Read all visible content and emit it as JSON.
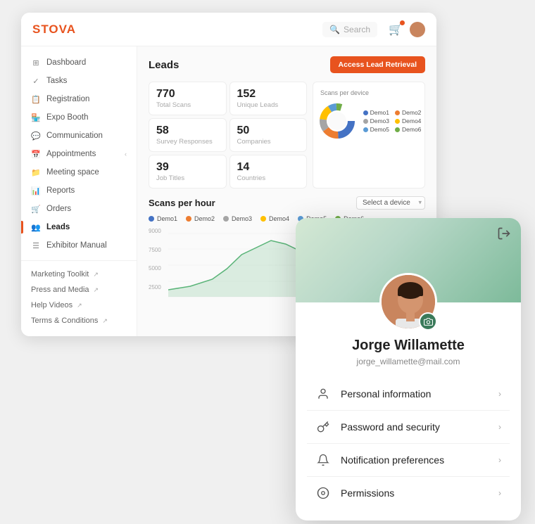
{
  "app": {
    "logo_text": "STOVA",
    "search_placeholder": "Search",
    "header": {
      "search_label": "Search"
    }
  },
  "sidebar": {
    "items": [
      {
        "id": "dashboard",
        "label": "Dashboard",
        "icon": "⊞",
        "active": false
      },
      {
        "id": "tasks",
        "label": "Tasks",
        "icon": "✓",
        "active": false
      },
      {
        "id": "registration",
        "label": "Registration",
        "icon": "📋",
        "active": false
      },
      {
        "id": "expo-booth",
        "label": "Expo Booth",
        "icon": "🏪",
        "active": false
      },
      {
        "id": "communication",
        "label": "Communication",
        "icon": "💬",
        "active": false
      },
      {
        "id": "appointments",
        "label": "Appointments",
        "icon": "📅",
        "active": false,
        "hasChevron": true
      },
      {
        "id": "meeting-space",
        "label": "Meeting space",
        "icon": "📁",
        "active": false
      },
      {
        "id": "reports",
        "label": "Reports",
        "icon": "📊",
        "active": false
      },
      {
        "id": "orders",
        "label": "Orders",
        "icon": "🛒",
        "active": false
      },
      {
        "id": "leads",
        "label": "Leads",
        "icon": "👥",
        "active": true
      },
      {
        "id": "exhibitor-manual",
        "label": "Exhibitor Manual",
        "icon": "☰",
        "active": false
      }
    ],
    "links": [
      {
        "label": "Marketing Toolkit",
        "icon": "↗"
      },
      {
        "label": "Press and Media",
        "icon": "↗"
      },
      {
        "label": "Help Videos",
        "icon": "↗"
      },
      {
        "label": "Terms & Conditions",
        "icon": "↗"
      }
    ]
  },
  "leads": {
    "title": "Leads",
    "access_btn_label": "Access Lead Retrieval",
    "stats": [
      {
        "value": "770",
        "label": "Total Scans"
      },
      {
        "value": "152",
        "label": "Unique Leads"
      },
      {
        "value": "58",
        "label": "Survey Responses"
      },
      {
        "value": "50",
        "label": "Companies"
      },
      {
        "value": "39",
        "label": "Job Titles"
      },
      {
        "value": "14",
        "label": "Countries"
      }
    ],
    "donut": {
      "title": "Scans per device",
      "segments": [
        {
          "label": "Demo1",
          "color": "#4472c4",
          "value": 30
        },
        {
          "label": "Demo2",
          "color": "#ed7d31",
          "value": 20
        },
        {
          "label": "Demo3",
          "color": "#a5a5a5",
          "value": 15
        },
        {
          "label": "Demo4",
          "color": "#ffc000",
          "value": 18
        },
        {
          "label": "Demo5",
          "color": "#5b9bd5",
          "value": 10
        },
        {
          "label": "Demo6",
          "color": "#70ad47",
          "value": 7
        }
      ]
    },
    "scans_per_hour": {
      "title": "Scans per hour",
      "device_select_placeholder": "Select a device",
      "y_labels": [
        "9000",
        "7500",
        "5000",
        "2500",
        ""
      ],
      "series": [
        {
          "label": "Demo1",
          "color": "#4472c4"
        },
        {
          "label": "Demo2",
          "color": "#ed7d31"
        },
        {
          "label": "Demo3",
          "color": "#a5a5a5"
        },
        {
          "label": "Demo4",
          "color": "#ffc000"
        },
        {
          "label": "Demo5",
          "color": "#5b9bd5"
        },
        {
          "label": "Demo6",
          "color": "#70ad47"
        }
      ]
    }
  },
  "profile": {
    "name": "Jorge Willamette",
    "email": "jorge_willamette@mail.com",
    "logout_label": "→",
    "menu_items": [
      {
        "id": "personal-info",
        "label": "Personal information",
        "icon": "👤"
      },
      {
        "id": "password-security",
        "label": "Password and security",
        "icon": "🔑"
      },
      {
        "id": "notifications",
        "label": "Notification preferences",
        "icon": "🔔"
      },
      {
        "id": "permissions",
        "label": "Permissions",
        "icon": "⚙️"
      }
    ]
  }
}
